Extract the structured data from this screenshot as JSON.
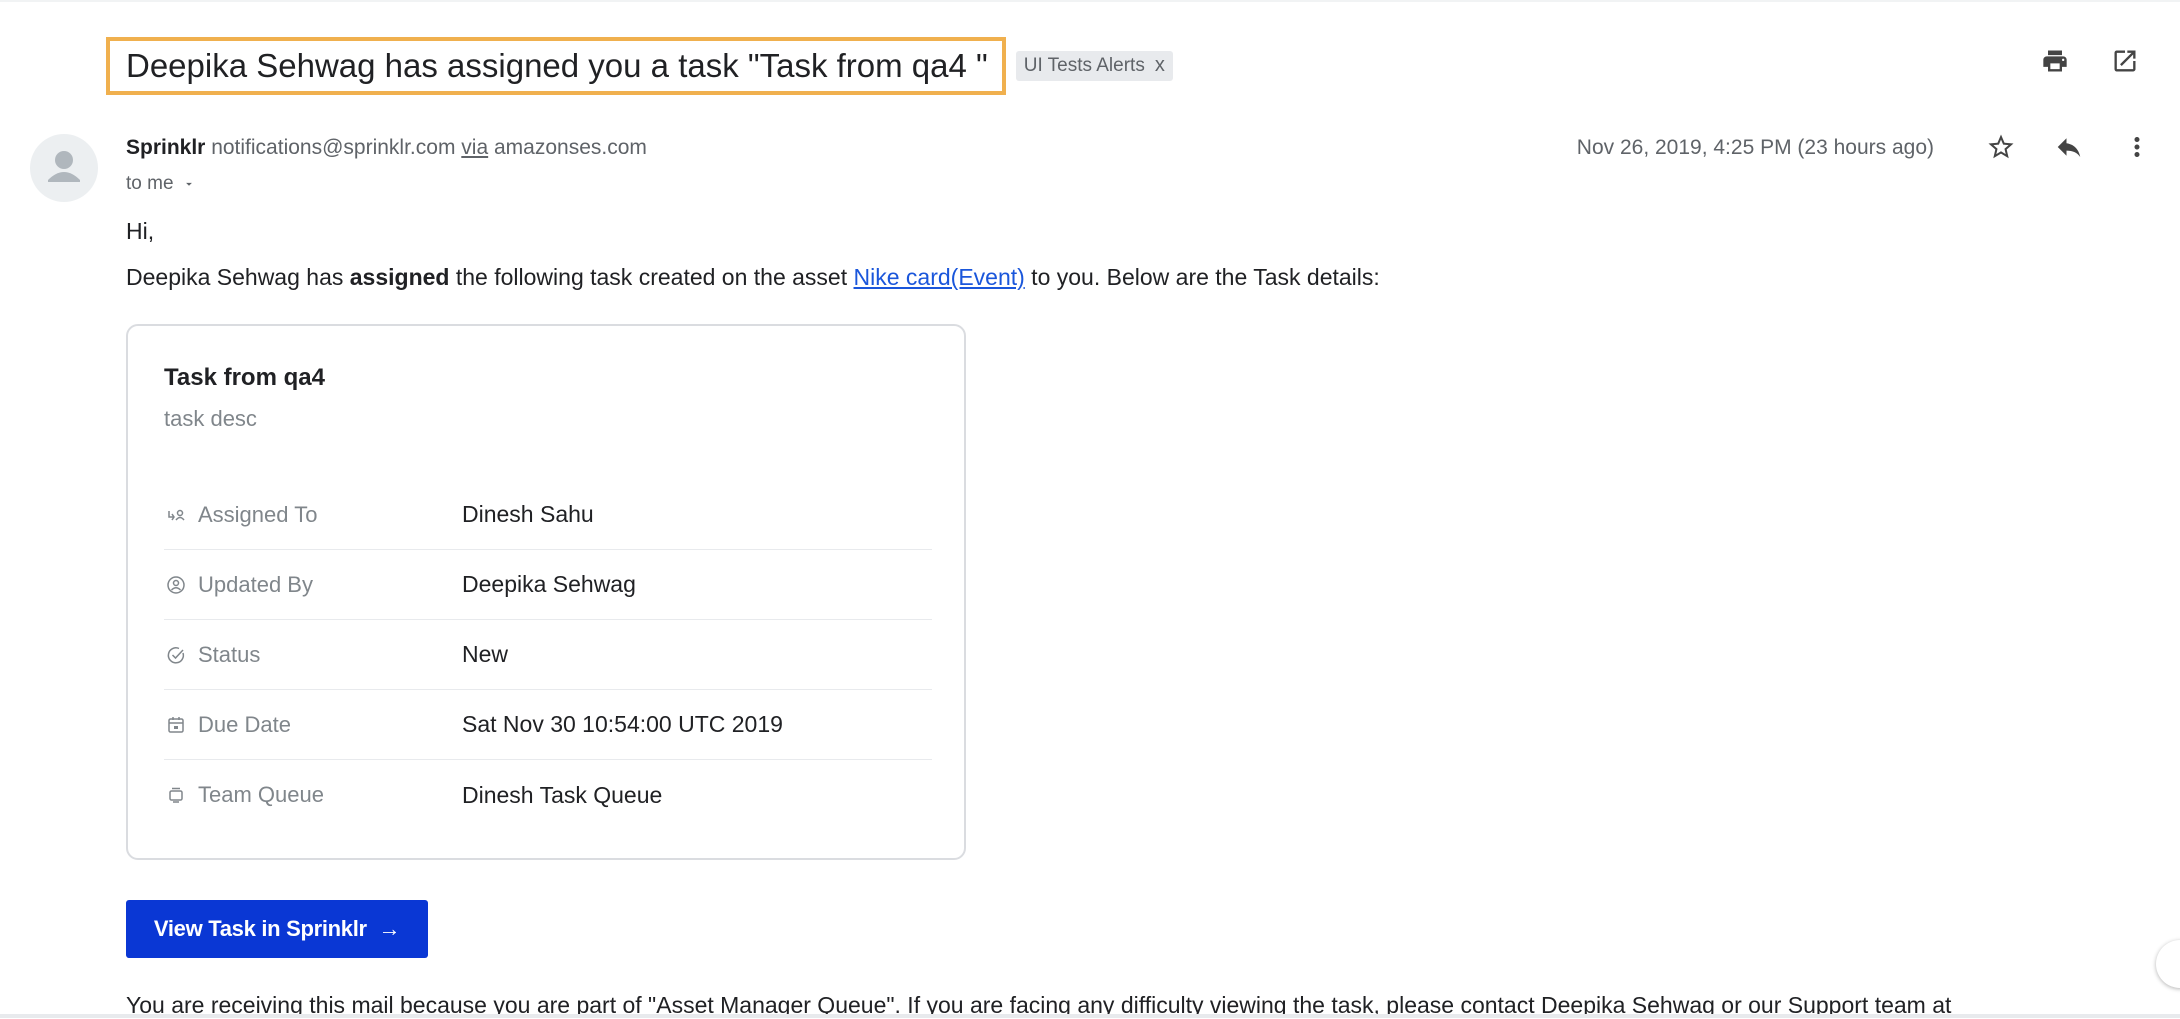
{
  "email": {
    "subject": "Deepika Sehwag has assigned you a task \"Task from qa4 \"",
    "label_chip": "UI Tests Alerts",
    "label_chip_close": "x",
    "sender_name": "Sprinklr",
    "sender_email": "notifications@sprinklr.com",
    "via_word": "via",
    "via_domain": "amazonses.com",
    "to_me": "to me",
    "date": "Nov 26, 2019, 4:25 PM (23 hours ago)"
  },
  "body": {
    "greeting": "Hi,",
    "intro_prefix": "Deepika Sehwag has ",
    "intro_bold": "assigned",
    "intro_mid": " the following task created on the asset ",
    "intro_link": "Nike card(Event)",
    "intro_suffix": " to you. Below are the Task details:",
    "footer": "You are receiving this mail because you are part of \"Asset Manager Queue\". If you are facing any difficulty viewing the task, please contact Deepika Sehwag or our Support team at"
  },
  "task": {
    "title": "Task from qa4",
    "description": "task desc",
    "rows": [
      {
        "label": "Assigned To",
        "value": "Dinesh Sahu",
        "icon": "assigned-to-icon"
      },
      {
        "label": "Updated By",
        "value": "Deepika Sehwag",
        "icon": "user-circle-icon"
      },
      {
        "label": "Status",
        "value": "New",
        "icon": "status-check-icon"
      },
      {
        "label": "Due Date",
        "value": "Sat Nov 30 10:54:00 UTC 2019",
        "icon": "calendar-icon"
      },
      {
        "label": "Team Queue",
        "value": "Dinesh Task Queue",
        "icon": "queue-icon"
      }
    ]
  },
  "cta": {
    "label": "View Task in Sprinklr",
    "arrow": "→"
  },
  "colors": {
    "highlight_border": "#f0b04e",
    "cta_bg": "#0a37d4",
    "link": "#1a56db"
  }
}
